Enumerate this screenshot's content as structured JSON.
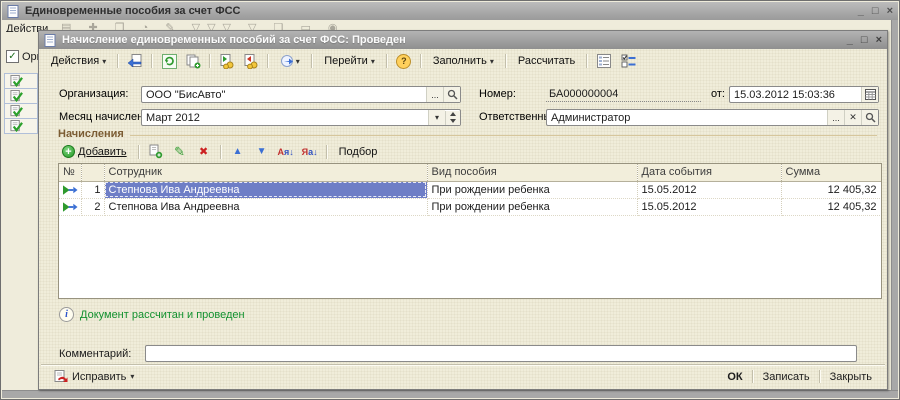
{
  "window": {
    "title": "Единовременные пособия за счет ФСС",
    "controls": {
      "minimize": "_",
      "maximize": "□",
      "close": "×"
    }
  },
  "outer": {
    "actions_label": "Действи",
    "org_checkbox_label": "Орга"
  },
  "icons": {
    "caret": "▾",
    "ellipsis": "...",
    "clear": "✕",
    "up": "▲",
    "down": "▼",
    "refresh": "↻",
    "pencil": "✎",
    "cross": "✖",
    "help": "?",
    "info": "i",
    "sort_asc_a": "А",
    "sort_asc_z": "я",
    "sort_arrow": "↓",
    "sort_desc_a": "Я",
    "sort_desc_z": "а",
    "outer_toolbar_glyphs": "▤ ✚ ❐ ◔ ✎ ▽▽▽ ▽ ❏ ▭ ◉"
  },
  "dialog": {
    "title": "Начисление единовременных пособий за счет ФСС: Проведен",
    "toolbar": {
      "actions": "Действия",
      "goto": "Перейти",
      "fill": "Заполнить",
      "calc": "Рассчитать"
    },
    "fields": {
      "org_label": "Организация:",
      "org_value": "ООО \"БисАвто\"",
      "month_label": "Месяц начисления:",
      "month_value": "Март 2012",
      "number_label": "Номер:",
      "number_value": "БА000000004",
      "from_label": "от:",
      "date_value": "15.03.2012 15:03:36",
      "responsible_label": "Ответственный:",
      "responsible_value": "Администратор"
    },
    "section": {
      "title": "Начисления",
      "add": "Добавить",
      "pick": "Подбор"
    },
    "table": {
      "headers": {
        "num": "№",
        "employee": "Сотрудник",
        "benefit": "Вид пособия",
        "date": "Дата события",
        "sum": "Сумма"
      },
      "rows": [
        {
          "num": "1",
          "employee": "Степнова Ива Андреевна",
          "benefit": "При рождении ребенка",
          "date": "15.05.2012",
          "sum": "12 405,32"
        },
        {
          "num": "2",
          "employee": "Степнова Ива Андреевна",
          "benefit": "При рождении ребенка",
          "date": "15.05.2012",
          "sum": "12 405,32"
        }
      ]
    },
    "status": "Документ рассчитан и проведен",
    "comment_label": "Комментарий:",
    "footer": {
      "fix": "Исправить",
      "ok": "ОК",
      "save": "Записать",
      "close": "Закрыть"
    }
  }
}
